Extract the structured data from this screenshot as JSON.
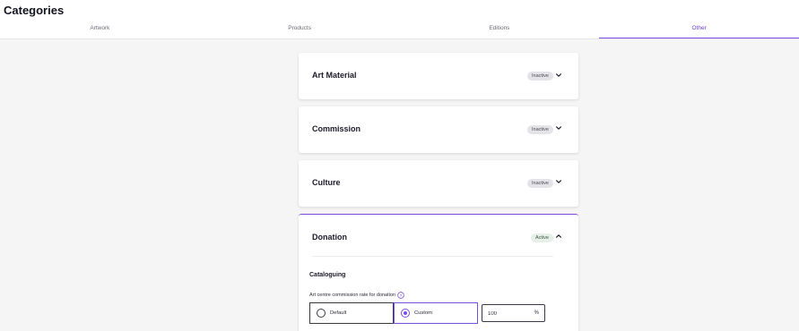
{
  "page": {
    "title": "Categories"
  },
  "tabs": [
    {
      "label": "Artwork",
      "active": false
    },
    {
      "label": "Products",
      "active": false
    },
    {
      "label": "Editions",
      "active": false
    },
    {
      "label": "Other",
      "active": true
    }
  ],
  "categories": [
    {
      "name": "Art Material",
      "status": "Inactive",
      "icon": "chevron-down-icon"
    },
    {
      "name": "Commission",
      "status": "Inactive",
      "icon": "chevron-down-icon"
    },
    {
      "name": "Culture",
      "status": "Inactive",
      "icon": "chevron-down-icon"
    },
    {
      "name": "Donation",
      "status": "Active",
      "icon": "chevron-up-icon"
    }
  ],
  "donation": {
    "section_title": "Cataloguing",
    "commission_label": "Art centre commission rate for donation",
    "help_icon": "help-icon",
    "options": [
      {
        "label": "Default",
        "selected": false
      },
      {
        "label": "Custom",
        "selected": true
      }
    ],
    "rate_value": "100",
    "rate_unit": "%"
  },
  "colors": {
    "accent": "#7b4ee0",
    "inactive_badge_bg": "#e4e4e8",
    "active_badge_bg": "#e6efe8",
    "page_bg": "#f5f5f5"
  }
}
